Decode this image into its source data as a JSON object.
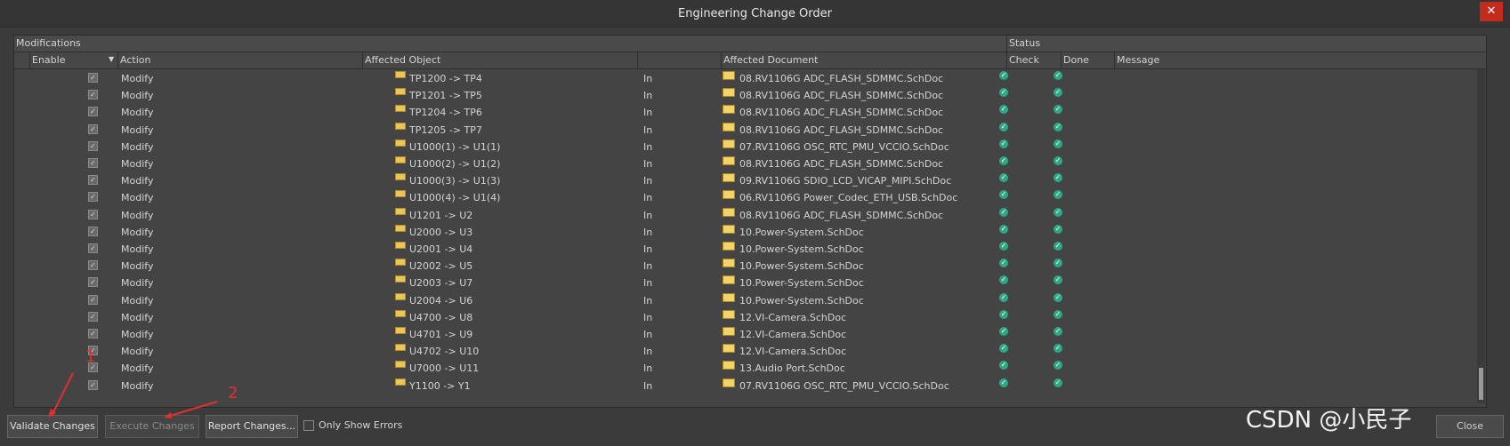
{
  "window": {
    "title": "Engineering Change Order",
    "close_label": "✕"
  },
  "group_header": {
    "modifications": "Modifications",
    "status": "Status"
  },
  "columns": {
    "enable": "Enable",
    "action": "Action",
    "affected_object": "Affected Object",
    "affected_document": "Affected Document",
    "check": "Check",
    "done": "Done",
    "message": "Message"
  },
  "rows": [
    {
      "enabled": true,
      "action": "Modify",
      "object": "TP1200 -> TP4",
      "dir": "In",
      "document": "08.RV1106G ADC_FLASH_SDMMC.SchDoc",
      "check": "ok",
      "done": "ok"
    },
    {
      "enabled": true,
      "action": "Modify",
      "object": "TP1201 -> TP5",
      "dir": "In",
      "document": "08.RV1106G ADC_FLASH_SDMMC.SchDoc",
      "check": "ok",
      "done": "ok"
    },
    {
      "enabled": true,
      "action": "Modify",
      "object": "TP1204 -> TP6",
      "dir": "In",
      "document": "08.RV1106G ADC_FLASH_SDMMC.SchDoc",
      "check": "ok",
      "done": "ok"
    },
    {
      "enabled": true,
      "action": "Modify",
      "object": "TP1205 -> TP7",
      "dir": "In",
      "document": "08.RV1106G ADC_FLASH_SDMMC.SchDoc",
      "check": "ok",
      "done": "ok"
    },
    {
      "enabled": true,
      "action": "Modify",
      "object": "U1000(1) -> U1(1)",
      "dir": "In",
      "document": "07.RV1106G OSC_RTC_PMU_VCCIO.SchDoc",
      "check": "ok",
      "done": "ok"
    },
    {
      "enabled": true,
      "action": "Modify",
      "object": "U1000(2) -> U1(2)",
      "dir": "In",
      "document": "08.RV1106G ADC_FLASH_SDMMC.SchDoc",
      "check": "ok",
      "done": "ok"
    },
    {
      "enabled": true,
      "action": "Modify",
      "object": "U1000(3) -> U1(3)",
      "dir": "In",
      "document": "09.RV1106G SDIO_LCD_VICAP_MIPI.SchDoc",
      "check": "ok",
      "done": "ok"
    },
    {
      "enabled": true,
      "action": "Modify",
      "object": "U1000(4) -> U1(4)",
      "dir": "In",
      "document": "06.RV1106G Power_Codec_ETH_USB.SchDoc",
      "check": "ok",
      "done": "ok"
    },
    {
      "enabled": true,
      "action": "Modify",
      "object": "U1201 -> U2",
      "dir": "In",
      "document": "08.RV1106G ADC_FLASH_SDMMC.SchDoc",
      "check": "ok",
      "done": "ok"
    },
    {
      "enabled": true,
      "action": "Modify",
      "object": "U2000 -> U3",
      "dir": "In",
      "document": "10.Power-System.SchDoc",
      "check": "ok",
      "done": "ok"
    },
    {
      "enabled": true,
      "action": "Modify",
      "object": "U2001 -> U4",
      "dir": "In",
      "document": "10.Power-System.SchDoc",
      "check": "ok",
      "done": "ok"
    },
    {
      "enabled": true,
      "action": "Modify",
      "object": "U2002 -> U5",
      "dir": "In",
      "document": "10.Power-System.SchDoc",
      "check": "ok",
      "done": "ok"
    },
    {
      "enabled": true,
      "action": "Modify",
      "object": "U2003 -> U7",
      "dir": "In",
      "document": "10.Power-System.SchDoc",
      "check": "ok",
      "done": "ok"
    },
    {
      "enabled": true,
      "action": "Modify",
      "object": "U2004 -> U6",
      "dir": "In",
      "document": "10.Power-System.SchDoc",
      "check": "ok",
      "done": "ok"
    },
    {
      "enabled": true,
      "action": "Modify",
      "object": "U4700 -> U8",
      "dir": "In",
      "document": "12.VI-Camera.SchDoc",
      "check": "ok",
      "done": "ok"
    },
    {
      "enabled": true,
      "action": "Modify",
      "object": "U4701 -> U9",
      "dir": "In",
      "document": "12.VI-Camera.SchDoc",
      "check": "ok",
      "done": "ok"
    },
    {
      "enabled": true,
      "action": "Modify",
      "object": "U4702 -> U10",
      "dir": "In",
      "document": "12.VI-Camera.SchDoc",
      "check": "ok",
      "done": "ok"
    },
    {
      "enabled": true,
      "action": "Modify",
      "object": "U7000 -> U11",
      "dir": "In",
      "document": "13.Audio Port.SchDoc",
      "check": "ok",
      "done": "ok"
    },
    {
      "enabled": true,
      "action": "Modify",
      "object": "Y1100 -> Y1",
      "dir": "In",
      "document": "07.RV1106G OSC_RTC_PMU_VCCIO.SchDoc",
      "check": "ok",
      "done": "ok"
    }
  ],
  "buttons": {
    "validate": "Validate Changes",
    "execute": "Execute Changes",
    "report": "Report Changes...",
    "only_show_errors": "Only Show Errors",
    "close": "Close"
  },
  "annotations": {
    "one": "1",
    "two": "2"
  },
  "watermark": "CSDN @小民子",
  "colors": {
    "accent_close": "#c42b1c",
    "status_ok": "#2fa886",
    "annotation": "#e0312f"
  }
}
